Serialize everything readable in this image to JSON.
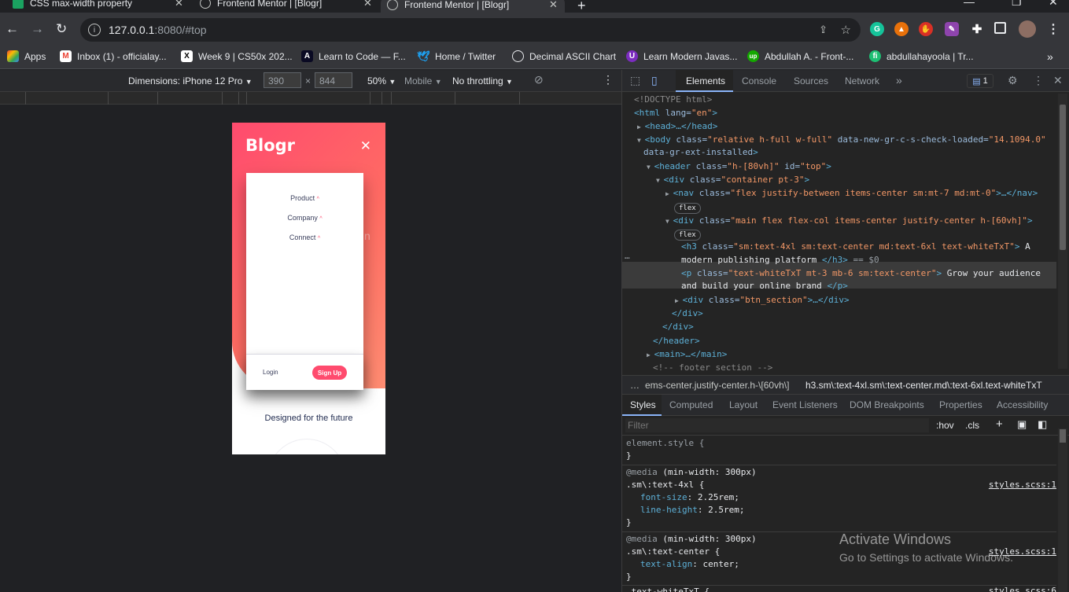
{
  "tabs": [
    {
      "title": "CSS max-width property",
      "active": false
    },
    {
      "title": "Frontend Mentor | [Blogr]",
      "active": false
    },
    {
      "title": "Frontend Mentor | [Blogr]",
      "active": true
    }
  ],
  "address": {
    "host": "127.0.0.1",
    "rest": ":8080/#top"
  },
  "bookmarks": [
    "Apps",
    "Inbox (1) - officialay...",
    "Week 9 | CS50x 202...",
    "Learn to Code — F...",
    "Home / Twitter",
    "Decimal ASCII Chart",
    "Learn Modern Javas...",
    "Abdullah A. - Front-...",
    "abdullahayoola | Tr..."
  ],
  "device_toolbar": {
    "dimensions_label": "Dimensions: iPhone 12 Pro",
    "width": "390",
    "height": "844",
    "times": "×",
    "zoom": "50%",
    "mode": "Mobile",
    "throttling": "No throttling"
  },
  "page": {
    "logo": "Blogr",
    "menu": [
      "Product",
      "Company",
      "Connect"
    ],
    "login": "Login",
    "signup": "Sign Up",
    "designed": "Designed for the future"
  },
  "devtools": {
    "tabs": [
      "Elements",
      "Console",
      "Sources",
      "Network"
    ],
    "active_tab": "Elements",
    "badge_count": "1",
    "dom": {
      "l1": "<!DOCTYPE html>",
      "html_tag": "<html",
      "html_attr": " lang=",
      "html_val": "\"en\"",
      "html_end": ">",
      "head": "<head>…</head>",
      "body_open": "<body",
      "body_attr1": " class=",
      "body_val1": "\"relative h-full w-full\"",
      "body_attr2": " data-new-gr-c-s-check-loaded=",
      "body_val2": "\"14.1094.0\"",
      "body_attr3": "data-gr-ext-installed",
      "body_end": ">",
      "header_open": "<header",
      "header_attr1": " class=",
      "header_val1": "\"h-[80vh]\"",
      "header_attr2": " id=",
      "header_val2": "\"top\"",
      "header_end": ">",
      "div1_open": "<div",
      "div1_attr": " class=",
      "div1_val": "\"container pt-3\"",
      "div1_end": ">",
      "nav_open": "<nav",
      "nav_attr": " class=",
      "nav_val": "\"flex justify-between items-center sm:mt-7 md:mt-0\"",
      "nav_end": ">…</nav>",
      "flex_badge": "flex",
      "div2_open": "<div",
      "div2_attr": " class=",
      "div2_val": "\"main flex flex-col items-center justify-center h-[60vh]\"",
      "div2_end": ">",
      "h3_open": "<h3",
      "h3_attr": " class=",
      "h3_val": "\"sm:text-4xl sm:text-center md:text-6xl text-whiteTxT\"",
      "h3_end": ">",
      "h3_text1": " A",
      "h3_text2": "modern publishing platform ",
      "h3_close": "</h3>",
      "h3_eq": " == $0",
      "p_open": "<p",
      "p_attr": " class=",
      "p_val": "\"text-whiteTxT mt-3 mb-6 sm:text-center\"",
      "p_end": ">",
      "p_text1": " Grow your audience",
      "p_text2": "and build your online brand ",
      "p_close": "</p>",
      "div3_open": "<div",
      "div3_attr": " class=",
      "div3_val": "\"btn_section\"",
      "div3_end": ">…</div>",
      "div_close": "</div>",
      "header_close": "</header>",
      "main": "<main>…</main>",
      "comment": "<!-- footer section -->",
      "ellipsis": "…"
    },
    "breadcrumbs": [
      "…",
      "ems-center.justify-center.h-\\[60vh\\]",
      "h3.sm\\:text-4xl.sm\\:text-center.md\\:text-6xl.text-whiteTxT"
    ],
    "subtabs": [
      "Styles",
      "Computed",
      "Layout",
      "Event Listeners",
      "DOM Breakpoints",
      "Properties",
      "Accessibility"
    ],
    "filter_placeholder": "Filter",
    "hov": ":hov",
    "cls": ".cls",
    "styles": {
      "element_style": "element.style {",
      "close": "}",
      "media": "@media",
      "media_cond": " (min-width: 300px)",
      "rule1_sel": ".sm\\:text-4xl {",
      "rule1_src": "styles.scss:1",
      "rule1_p1_name": "font-size",
      "rule1_p1_val": ": 2.25rem;",
      "rule1_p2_name": "line-height",
      "rule1_p2_val": ": 2.5rem;",
      "rule2_sel": ".sm\\:text-center {",
      "rule2_src": "styles.scss:1",
      "rule2_p1_name": "text-align",
      "rule2_p1_val": ": center;",
      "rule3_sel": ".text-whiteTxT {",
      "rule3_src": "styles.scss:6"
    }
  },
  "watermark": {
    "line1": "Activate Windows",
    "line2": "Go to Settings to activate Windows."
  }
}
